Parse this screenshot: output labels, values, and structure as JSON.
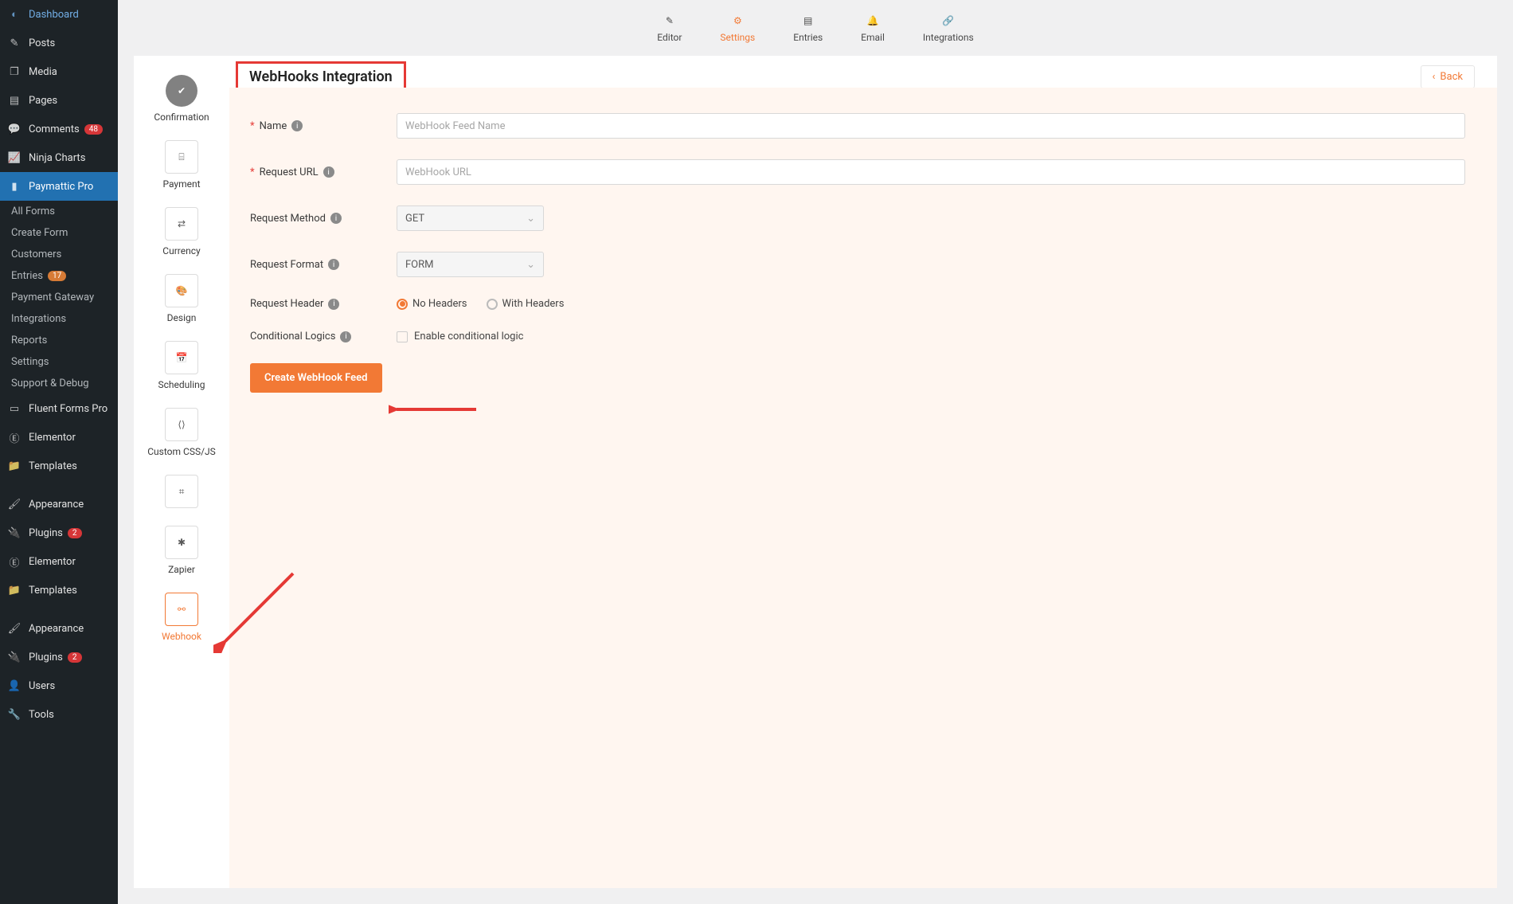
{
  "wp_sidebar": {
    "items": [
      {
        "label": "Dashboard",
        "icon": "dashboard"
      },
      {
        "label": "Posts",
        "icon": "pin"
      },
      {
        "label": "Media",
        "icon": "media"
      },
      {
        "label": "Pages",
        "icon": "pages"
      },
      {
        "label": "Comments",
        "icon": "comment",
        "badge": "48",
        "badge_color": "red"
      },
      {
        "label": "Ninja Charts",
        "icon": "chart"
      },
      {
        "label": "Paymattic Pro",
        "icon": "payment",
        "active": true
      }
    ],
    "sub_items": [
      {
        "label": "All Forms"
      },
      {
        "label": "Create Form"
      },
      {
        "label": "Customers"
      },
      {
        "label": "Entries",
        "badge": "17",
        "badge_color": "orange"
      },
      {
        "label": "Payment Gateway"
      },
      {
        "label": "Integrations"
      },
      {
        "label": "Reports"
      },
      {
        "label": "Settings"
      },
      {
        "label": "Support & Debug"
      }
    ],
    "items2": [
      {
        "label": "Fluent Forms Pro",
        "icon": "forms"
      },
      {
        "label": "Elementor",
        "icon": "elementor"
      },
      {
        "label": "Templates",
        "icon": "templates"
      },
      {
        "label": "Appearance",
        "icon": "appearance"
      },
      {
        "label": "Plugins",
        "icon": "plugins",
        "badge": "2",
        "badge_color": "red"
      },
      {
        "label": "Elementor",
        "icon": "elementor"
      },
      {
        "label": "Templates",
        "icon": "templates"
      },
      {
        "label": "Appearance",
        "icon": "appearance"
      },
      {
        "label": "Plugins",
        "icon": "plugins",
        "badge": "2",
        "badge_color": "red"
      },
      {
        "label": "Users",
        "icon": "users"
      },
      {
        "label": "Tools",
        "icon": "tools"
      }
    ]
  },
  "topbar": {
    "items": [
      {
        "label": "Editor",
        "icon": "editor"
      },
      {
        "label": "Settings",
        "icon": "settings",
        "active": true
      },
      {
        "label": "Entries",
        "icon": "entries"
      },
      {
        "label": "Email",
        "icon": "email"
      },
      {
        "label": "Integrations",
        "icon": "integrations"
      }
    ]
  },
  "side_tabs": [
    {
      "label": "Confirmation",
      "icon": "check",
      "first": true
    },
    {
      "label": "Payment",
      "icon": "wallet"
    },
    {
      "label": "Currency",
      "icon": "currency"
    },
    {
      "label": "Design",
      "icon": "design"
    },
    {
      "label": "Scheduling",
      "icon": "calendar"
    },
    {
      "label": "Custom CSS/JS",
      "icon": "code"
    },
    {
      "label": "",
      "icon": "slack",
      "nolabel": true
    },
    {
      "label": "Zapier",
      "icon": "zapier"
    },
    {
      "label": "Webhook",
      "icon": "webhook",
      "active": true
    }
  ],
  "panel": {
    "title": "WebHooks Integration",
    "back": "Back",
    "form": {
      "name_label": "Name",
      "name_placeholder": "WebHook Feed Name",
      "url_label": "Request URL",
      "url_placeholder": "WebHook URL",
      "method_label": "Request Method",
      "method_value": "GET",
      "format_label": "Request Format",
      "format_value": "FORM",
      "header_label": "Request Header",
      "header_opt1": "No Headers",
      "header_opt2": "With Headers",
      "cond_label": "Conditional Logics",
      "cond_check": "Enable conditional logic",
      "submit": "Create WebHook Feed"
    }
  }
}
